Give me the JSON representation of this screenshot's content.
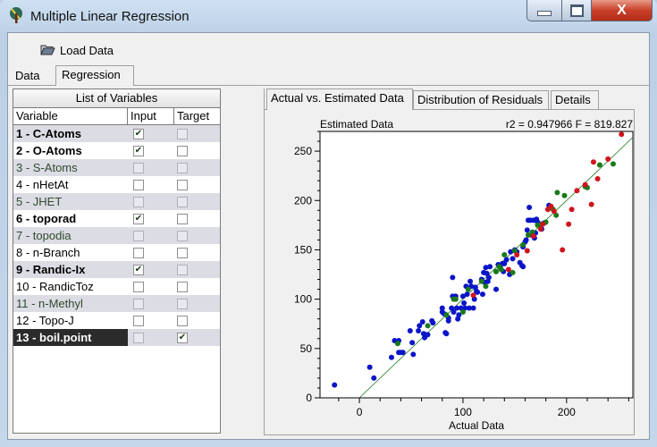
{
  "window": {
    "title": "Multiple Linear Regression",
    "close_glyph": "X"
  },
  "toolbar": {
    "load_label": "Load Data"
  },
  "tabs": [
    {
      "label": "Data"
    },
    {
      "label": "Regression"
    }
  ],
  "variables": {
    "title": "List of Variables",
    "headers": {
      "variable": "Variable",
      "input": "Input",
      "target": "Target"
    },
    "rows": [
      {
        "label": "1 - C-Atoms",
        "input": true,
        "target": false,
        "bold": true,
        "disabled": false,
        "selected": false
      },
      {
        "label": "2 - O-Atoms",
        "input": true,
        "target": false,
        "bold": true,
        "disabled": false,
        "selected": false
      },
      {
        "label": "3 - S-Atoms",
        "input": false,
        "target": false,
        "bold": false,
        "disabled": true,
        "selected": false
      },
      {
        "label": "4 - nHetAt",
        "input": false,
        "target": false,
        "bold": false,
        "disabled": false,
        "selected": false
      },
      {
        "label": "5 - JHET",
        "input": false,
        "target": false,
        "bold": false,
        "disabled": true,
        "selected": false
      },
      {
        "label": "6 - toporad",
        "input": true,
        "target": false,
        "bold": true,
        "disabled": false,
        "selected": false
      },
      {
        "label": "7 - topodia",
        "input": false,
        "target": false,
        "bold": false,
        "disabled": true,
        "selected": false
      },
      {
        "label": "8 - n-Branch",
        "input": false,
        "target": false,
        "bold": false,
        "disabled": false,
        "selected": false
      },
      {
        "label": "9 - Randic-Ix",
        "input": true,
        "target": false,
        "bold": true,
        "disabled": false,
        "selected": false
      },
      {
        "label": "10 - RandicToz",
        "input": false,
        "target": false,
        "bold": false,
        "disabled": false,
        "selected": false
      },
      {
        "label": "11 - n-Methyl",
        "input": false,
        "target": false,
        "bold": false,
        "disabled": true,
        "selected": false
      },
      {
        "label": "12 - Topo-J",
        "input": false,
        "target": false,
        "bold": false,
        "disabled": false,
        "selected": false
      },
      {
        "label": "13 - boil.point",
        "input": false,
        "target": true,
        "bold": true,
        "disabled": false,
        "selected": true
      }
    ]
  },
  "result_tabs": [
    {
      "label": "Actual vs. Estimated Data"
    },
    {
      "label": "Distribution of Residuals"
    },
    {
      "label": "Details"
    }
  ],
  "chart_data": {
    "type": "scatter",
    "title": "Estimated Data",
    "stats_label": "r2 = 0.947966  F = 819.827",
    "r2": 0.947966,
    "F": 819.827,
    "xlabel": "Actual Data",
    "ylabel": "Estimated Data",
    "xlim": [
      -38,
      264
    ],
    "ylim": [
      0,
      270
    ],
    "xticks": [
      0,
      100,
      200
    ],
    "yticks": [
      0,
      50,
      100,
      150,
      200,
      250
    ],
    "grid": false,
    "fit_line": {
      "x0": 0,
      "y0": 0,
      "x1": 264,
      "y1": 264,
      "color": "#1a7a1a"
    },
    "series": [
      {
        "name": "blue",
        "color": "#0a14c8",
        "points": [
          [
            -24,
            13
          ],
          [
            10,
            31
          ],
          [
            14,
            20
          ],
          [
            31,
            41
          ],
          [
            34,
            58
          ],
          [
            38,
            58
          ],
          [
            38,
            46
          ],
          [
            40,
            46
          ],
          [
            42,
            46
          ],
          [
            49,
            68
          ],
          [
            51,
            56
          ],
          [
            52,
            44
          ],
          [
            57,
            68
          ],
          [
            58,
            73
          ],
          [
            61,
            77
          ],
          [
            62,
            65
          ],
          [
            63,
            61
          ],
          [
            64,
            64
          ],
          [
            66,
            64
          ],
          [
            70,
            78
          ],
          [
            71,
            76
          ],
          [
            80,
            87
          ],
          [
            80,
            91
          ],
          [
            82,
            85
          ],
          [
            83,
            66
          ],
          [
            84,
            65
          ],
          [
            86,
            81
          ],
          [
            86,
            78
          ],
          [
            89,
            91
          ],
          [
            90,
            122
          ],
          [
            90,
            103
          ],
          [
            91,
            87
          ],
          [
            93,
            103
          ],
          [
            94,
            91
          ],
          [
            95,
            80
          ],
          [
            96,
            84
          ],
          [
            98,
            91
          ],
          [
            100,
            103
          ],
          [
            101,
            96
          ],
          [
            102,
            91
          ],
          [
            103,
            113
          ],
          [
            104,
            105
          ],
          [
            106,
            91
          ],
          [
            107,
            118
          ],
          [
            108,
            113
          ],
          [
            110,
            91
          ],
          [
            111,
            100
          ],
          [
            112,
            112
          ],
          [
            113,
            108
          ],
          [
            114,
            107
          ],
          [
            118,
            120
          ],
          [
            119,
            105
          ],
          [
            120,
            127
          ],
          [
            121,
            117
          ],
          [
            122,
            132
          ],
          [
            123,
            126
          ],
          [
            124,
            118
          ],
          [
            125,
            122
          ],
          [
            126,
            133
          ],
          [
            132,
            128
          ],
          [
            132,
            110
          ],
          [
            134,
            135
          ],
          [
            136,
            132
          ],
          [
            138,
            136
          ],
          [
            139,
            128
          ],
          [
            140,
            136
          ],
          [
            142,
            140
          ],
          [
            145,
            125
          ],
          [
            146,
            148
          ],
          [
            148,
            141
          ],
          [
            150,
            150
          ],
          [
            152,
            148
          ],
          [
            155,
            137
          ],
          [
            157,
            134
          ],
          [
            158,
            133
          ],
          [
            158,
            153
          ],
          [
            160,
            158
          ],
          [
            161,
            160
          ],
          [
            162,
            170
          ],
          [
            163,
            180
          ],
          [
            164,
            193
          ],
          [
            165,
            180
          ],
          [
            166,
            165
          ],
          [
            168,
            180
          ],
          [
            169,
            162
          ],
          [
            170,
            167
          ],
          [
            171,
            181
          ],
          [
            172,
            178
          ],
          [
            175,
            176
          ],
          [
            176,
            171
          ],
          [
            178,
            177
          ],
          [
            183,
            195
          ]
        ]
      },
      {
        "name": "green",
        "color": "#1a7a1a",
        "points": [
          [
            37,
            55
          ],
          [
            66,
            73
          ],
          [
            84,
            84
          ],
          [
            91,
            100
          ],
          [
            93,
            100
          ],
          [
            100,
            87
          ],
          [
            105,
            110
          ],
          [
            118,
            118
          ],
          [
            122,
            113
          ],
          [
            132,
            128
          ],
          [
            135,
            133
          ],
          [
            137,
            130
          ],
          [
            140,
            145
          ],
          [
            148,
            127
          ],
          [
            150,
            149
          ],
          [
            158,
            155
          ],
          [
            163,
            165
          ],
          [
            167,
            168
          ],
          [
            172,
            175
          ],
          [
            176,
            176
          ],
          [
            180,
            178
          ],
          [
            187,
            191
          ],
          [
            190,
            185
          ],
          [
            191,
            208
          ],
          [
            198,
            205
          ],
          [
            218,
            214
          ],
          [
            220,
            213
          ],
          [
            232,
            236
          ],
          [
            245,
            237
          ]
        ]
      },
      {
        "name": "red",
        "color": "#d0141e",
        "points": [
          [
            110,
            104
          ],
          [
            144,
            130
          ],
          [
            152,
            145
          ],
          [
            162,
            149
          ],
          [
            168,
            164
          ],
          [
            175,
            171
          ],
          [
            177,
            176
          ],
          [
            182,
            191
          ],
          [
            185,
            194
          ],
          [
            188,
            189
          ],
          [
            196,
            150
          ],
          [
            202,
            176
          ],
          [
            205,
            191
          ],
          [
            210,
            210
          ],
          [
            218,
            216
          ],
          [
            224,
            196
          ],
          [
            226,
            239
          ],
          [
            230,
            222
          ],
          [
            240,
            242
          ],
          [
            253,
            267
          ]
        ]
      }
    ]
  }
}
